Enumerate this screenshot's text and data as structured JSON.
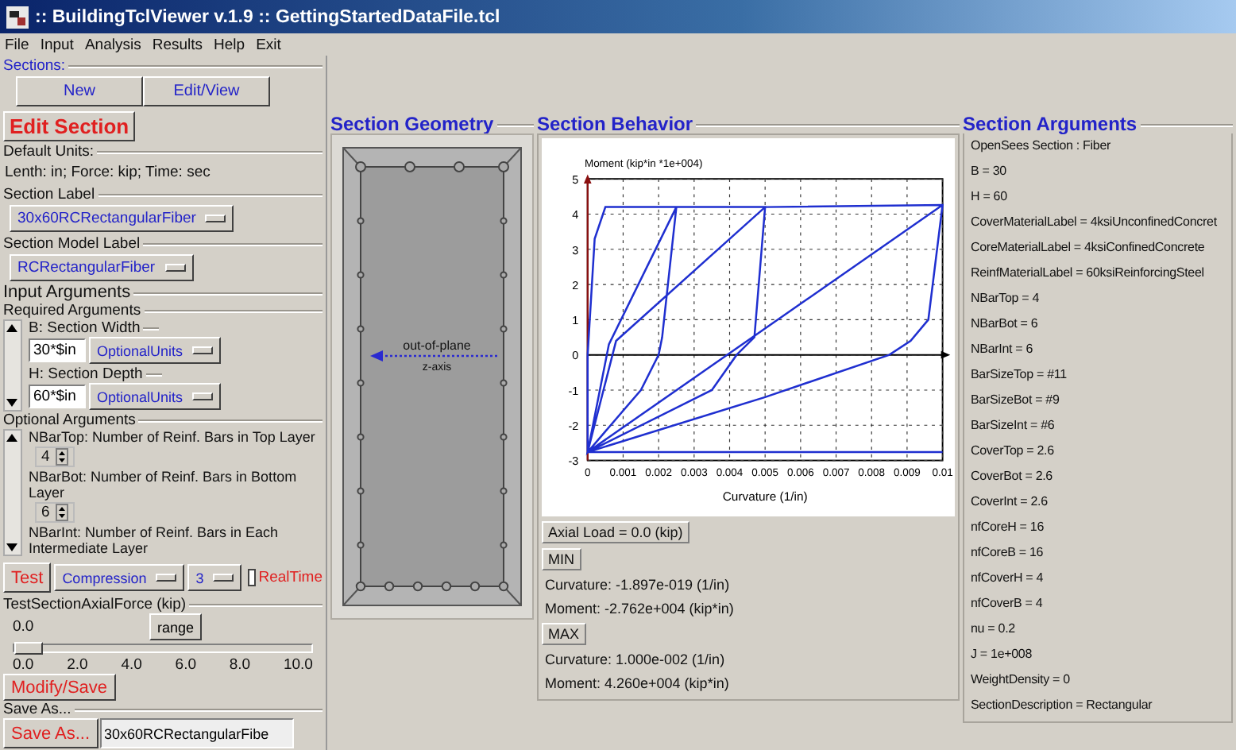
{
  "window": {
    "title": ":: BuildingTclViewer v.1.9 :: GettingStartedDataFile.tcl"
  },
  "menu": [
    "File",
    "Input",
    "Analysis",
    "Results",
    "Help",
    "Exit"
  ],
  "sections": {
    "label": "Sections:",
    "buttons": [
      "New",
      "Edit/View"
    ]
  },
  "edit_section": {
    "title": "Edit Section",
    "default_units": {
      "label": "Default Units:",
      "text": "Lenth: in; Force: kip; Time: sec"
    },
    "section_label": {
      "label": "Section Label",
      "value": "30x60RCRectangularFiber"
    },
    "section_model_label": {
      "label": "Section Model Label",
      "value": "RCRectangularFiber"
    },
    "input_arguments": "Input Arguments",
    "required": {
      "label": "Required Arguments",
      "fields": [
        {
          "label": "B: Section Width",
          "value": "30*$in",
          "units": "OptionalUnits"
        },
        {
          "label": "H: Section Depth",
          "value": "60*$in",
          "units": "OptionalUnits"
        }
      ]
    },
    "optional": {
      "label": "Optional Arguments",
      "fields": [
        {
          "label": "NBarTop: Number of Reinf. Bars in Top Layer",
          "value": "4"
        },
        {
          "label": "NBarBot: Number of Reinf. Bars in Bottom Layer",
          "value": "6"
        },
        {
          "label": "NBarInt: Number of Reinf. Bars in Each Intermediate Layer"
        }
      ]
    },
    "test": {
      "button": "Test",
      "mode": "Compression",
      "count": "3",
      "realtime": {
        "label": "RealTime",
        "checked": false
      }
    },
    "axial_force": {
      "label": "TestSectionAxialForce (kip)",
      "value": "0.0",
      "level": 0,
      "range_button": "range",
      "ticks": [
        "0.0",
        "2.0",
        "4.0",
        "6.0",
        "8.0",
        "10.0"
      ]
    },
    "modify_button": "Modify/Save",
    "save_as": {
      "label": "Save As...",
      "button": "Save As...",
      "value": "30x60RCRectangularFibe"
    }
  },
  "geometry": {
    "title": "Section Geometry",
    "arrow_label": "out-of-plane",
    "axis_label": "z-axis"
  },
  "behavior": {
    "title": "Section Behavior",
    "chart_data": {
      "type": "line",
      "ylabel": "Moment (kip*in *1e+004)",
      "xlabel": "Curvature (1/in)",
      "x": [
        0.01,
        0,
        0,
        0.0002,
        0.0005,
        0.0025,
        0.0021,
        0.002,
        0.0015,
        0,
        0.0006,
        0.0025,
        0.005,
        0.0047,
        0.0042,
        0.0035,
        0,
        0.0008,
        0.005,
        0.01,
        0.0096,
        0.0091,
        0.0085,
        0.005,
        0,
        0.01
      ],
      "grid": true,
      "series": [
        {
          "color": "#1f2fd0",
          "values": [
            -2.76,
            -2.76,
            0,
            3.3,
            4.2,
            4.2,
            0.5,
            0,
            -1,
            -2.76,
            0.3,
            4.2,
            4.2,
            0.5,
            0,
            -1,
            -2.76,
            0.4,
            4.2,
            4.26,
            1,
            0.4,
            0,
            -1.2,
            -2.76,
            4.26
          ]
        }
      ],
      "xlim": [
        0,
        0.01
      ],
      "ylim": [
        -3,
        5
      ],
      "xticks": [
        0,
        0.001,
        0.002,
        0.003,
        0.004,
        0.005,
        0.006,
        0.007,
        0.008,
        0.009,
        0.01
      ],
      "yticks": [
        -3,
        -2,
        -1,
        0,
        1,
        2,
        3,
        4,
        5
      ]
    },
    "axial_load": "Axial Load = 0.0 (kip)",
    "extremes": [
      {
        "label": "MIN",
        "curvature": "Curvature: -1.897e-019 (1/in)",
        "moment": "Moment: -2.762e+004 (kip*in)"
      },
      {
        "label": "MAX",
        "curvature": "Curvature: 1.000e-002 (1/in)",
        "moment": "Moment: 4.260e+004 (kip*in)"
      }
    ]
  },
  "arguments": {
    "title": "Section Arguments",
    "lines": [
      "OpenSees Section : Fiber",
      "B = 30",
      "H = 60",
      "CoverMaterialLabel = 4ksiUnconfinedConcret",
      "CoreMaterialLabel = 4ksiConfinedConcrete",
      "ReinfMaterialLabel = 60ksiReinforcingSteel",
      "NBarTop = 4",
      "NBarBot = 6",
      "NBarInt = 6",
      "BarSizeTop = #11",
      "BarSizeBot = #9",
      "BarSizeInt = #6",
      "CoverTop = 2.6",
      "CoverBot = 2.6",
      "CoverInt = 2.6",
      "nfCoreH = 16",
      "nfCoreB = 16",
      "nfCoverH = 4",
      "nfCoverB = 4",
      "nu = 0.2",
      "J = 1e+008",
      "WeightDensity = 0",
      "SectionDescription = Rectangular"
    ]
  }
}
